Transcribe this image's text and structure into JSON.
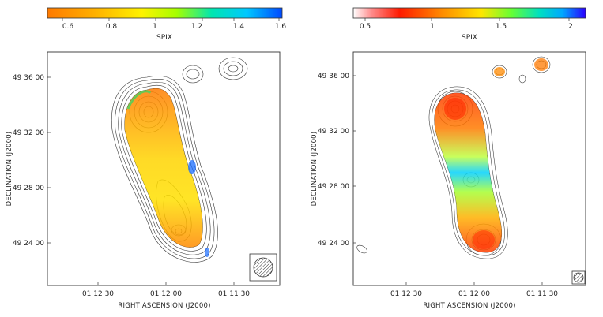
{
  "panels": [
    {
      "colorbar": {
        "label": "SPIX",
        "ticks": [
          "0.6",
          "0.8",
          "1",
          "1.2",
          "1.4",
          "1.6"
        ],
        "gradient": [
          "#ff7a00",
          "#ffb000",
          "#fff200",
          "#a6ff00",
          "#00e6b0",
          "#00c8ff",
          "#0048ff"
        ]
      },
      "xlabel": "RIGHT ASCENSION  (J2000)",
      "ylabel": "DECLINATION  (J2000)",
      "xticks": [
        "01 12 30",
        "01 12 00",
        "01 11 30"
      ],
      "yticks": [
        "49 36 00",
        "49 32 00",
        "49 28 00",
        "49 24 00"
      ]
    },
    {
      "colorbar": {
        "label": "SPIX",
        "ticks": [
          "0.5",
          "1",
          "1.5",
          "2"
        ],
        "gradient": [
          "#ffffff",
          "#ff6a6a",
          "#ff1a00",
          "#ff8a00",
          "#ffe600",
          "#66ff33",
          "#00e0c0",
          "#00a8ff",
          "#2a00ff"
        ]
      },
      "xlabel": "RIGHT ASCENSION  (J2000)",
      "ylabel": "DECLINATION  (J2000)",
      "xticks": [
        "01 12 30",
        "01 12 00",
        "01 11 30"
      ],
      "yticks": [
        "49 36 00",
        "49 32 00",
        "49 28 00",
        "49 24 00"
      ]
    }
  ]
}
